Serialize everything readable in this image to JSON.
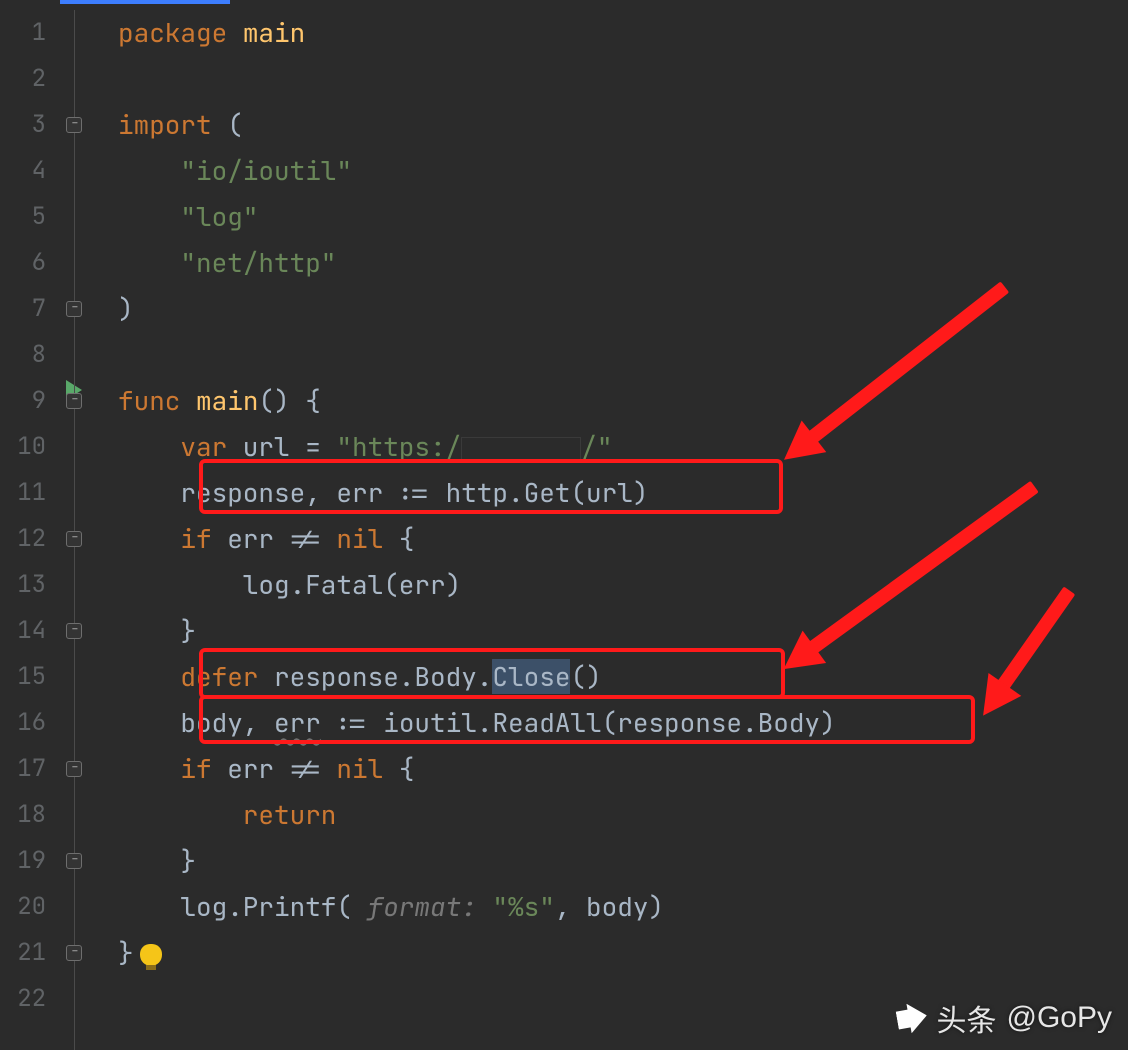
{
  "line_numbers": [
    "1",
    "2",
    "3",
    "4",
    "5",
    "6",
    "7",
    "8",
    "9",
    "10",
    "11",
    "12",
    "13",
    "14",
    "15",
    "16",
    "17",
    "18",
    "19",
    "20",
    "21",
    "22"
  ],
  "fold_markers": {
    "3": true,
    "7": true,
    "9": true,
    "12": true,
    "14": true,
    "17": true,
    "19": true,
    "21": true
  },
  "run_line": 9,
  "code": {
    "l1_kw": "package",
    "l1_ident": "main",
    "l3_kw": "import",
    "l3_paren": " (",
    "l4": "    \"io/ioutil\"",
    "l5": "    \"log\"",
    "l6": "    \"net/http\"",
    "l7": ")",
    "l9_kw": "func",
    "l9_name": "main",
    "l9_rest": "() {",
    "l10_kw": "    var",
    "l10_a": " url = ",
    "l10_s1": "\"https:/",
    "l10_s2": "/\"",
    "l11": "    response, err := http.Get(url)",
    "l12_kw": "    if",
    "l12_a": " err != ",
    "l12_nil": "nil",
    "l12_b": " {",
    "l13": "        log.Fatal(err)",
    "l14": "    }",
    "l15_kw": "    defer",
    "l15_a": " response.Body.",
    "l15_close": "Close",
    "l15_b": "()",
    "l16_a": "    body, ",
    "l16_err": "err",
    "l16_b": " := ioutil.ReadAll(response.Body)",
    "l17_kw": "    if",
    "l17_a": " err != ",
    "l17_nil": "nil",
    "l17_b": " {",
    "l18_kw": "        return",
    "l19": "    }",
    "l20_a": "    log.Printf( ",
    "l20_hint": "format:",
    "l20_s": " \"%s\"",
    "l20_b": ", body)",
    "l21": "}"
  },
  "highlight_boxes": [
    11,
    15,
    16
  ],
  "watermark": {
    "prefix": "头条",
    "handle": "@GoPy"
  }
}
